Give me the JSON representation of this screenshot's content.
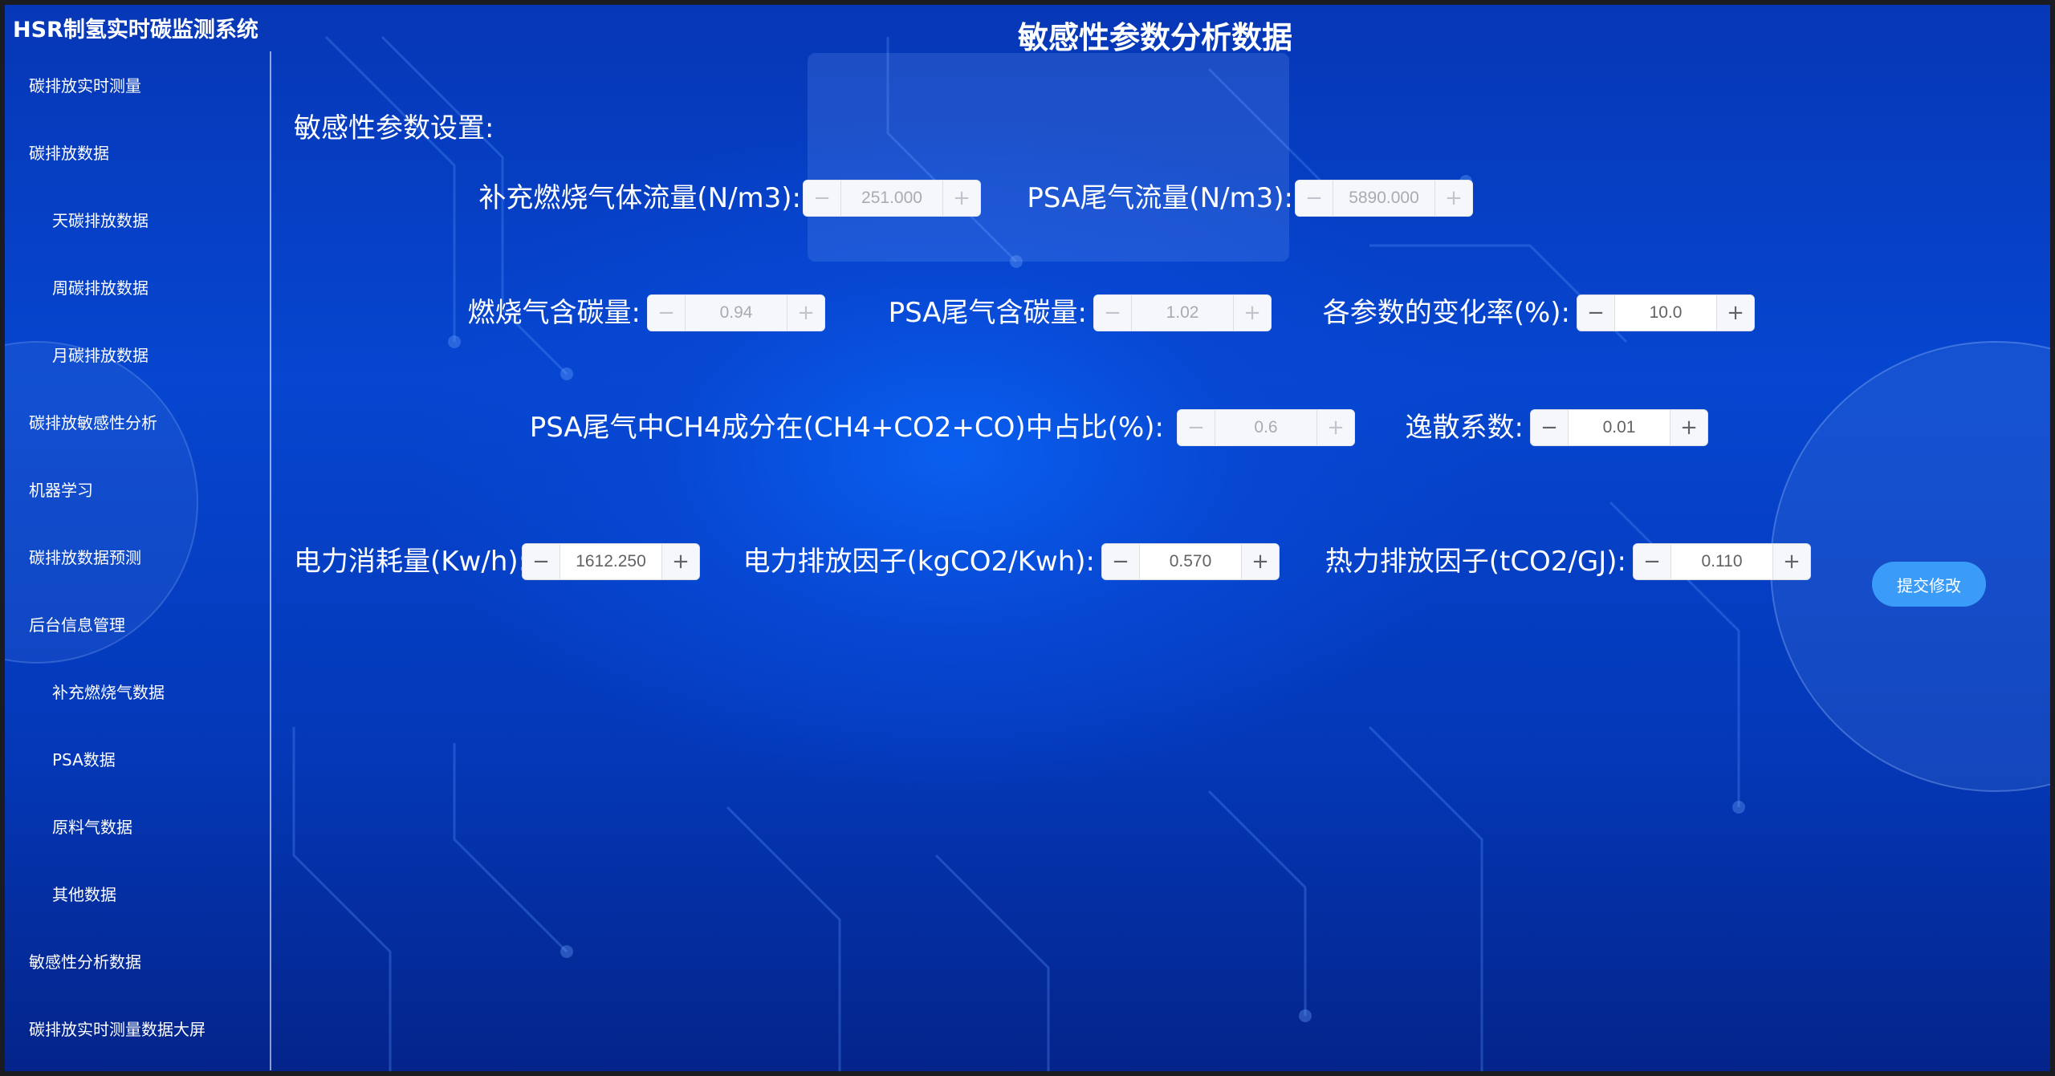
{
  "app": {
    "title": "HSR制氢实时碳监测系统",
    "page_title": "敏感性参数分析数据"
  },
  "sidebar": {
    "items": [
      {
        "label": "碳排放实时测量",
        "level": 1
      },
      {
        "label": "碳排放数据",
        "level": 1
      },
      {
        "label": "天碳排放数据",
        "level": 2
      },
      {
        "label": "周碳排放数据",
        "level": 2
      },
      {
        "label": "月碳排放数据",
        "level": 2
      },
      {
        "label": "碳排放敏感性分析",
        "level": 1
      },
      {
        "label": "机器学习",
        "level": 1
      },
      {
        "label": "碳排放数据预测",
        "level": 1
      },
      {
        "label": "后台信息管理",
        "level": 1
      },
      {
        "label": "补充燃烧气数据",
        "level": 2
      },
      {
        "label": "PSA数据",
        "level": 2
      },
      {
        "label": "原料气数据",
        "level": 2
      },
      {
        "label": "其他数据",
        "level": 2
      },
      {
        "label": "敏感性分析数据",
        "level": 1
      },
      {
        "label": "碳排放实时测量数据大屏",
        "level": 1
      }
    ]
  },
  "form": {
    "section_title": "敏感性参数设置:",
    "fields": {
      "supplement_gas_flow": {
        "label": "补充燃烧气体流量(N/m3):",
        "value": "251.000",
        "disabled": true
      },
      "psa_tail_gas_flow": {
        "label": "PSA尾气流量(N/m3):",
        "value": "5890.000",
        "disabled": true
      },
      "combustion_gas_carbon": {
        "label": "燃烧气含碳量:",
        "value": "0.94",
        "disabled": true
      },
      "psa_tail_gas_carbon": {
        "label": "PSA尾气含碳量:",
        "value": "1.02",
        "disabled": true
      },
      "param_change_rate": {
        "label": "各参数的变化率(%):",
        "value": "10.0",
        "disabled": false
      },
      "psa_ch4_ratio": {
        "label": "PSA尾气中CH4成分在(CH4+CO2+CO)中占比(%):",
        "value": "0.6",
        "disabled": true
      },
      "escape_coefficient": {
        "label": "逸散系数:",
        "value": "0.01",
        "disabled": false
      },
      "power_consumption": {
        "label": "电力消耗量(Kw/h):",
        "value": "1612.250",
        "disabled": false
      },
      "power_emission_factor": {
        "label": "电力排放因子(kgCO2/Kwh):",
        "value": "0.570",
        "disabled": false
      },
      "heat_emission_factor": {
        "label": "热力排放因子(tCO2/GJ):",
        "value": "0.110",
        "disabled": false
      }
    },
    "submit_label": "提交修改"
  },
  "icons": {
    "minus": "minus-icon",
    "plus": "plus-icon"
  },
  "colors": {
    "background_blue": "#0747d2",
    "submit_button": "#3a9cf8",
    "text": "#ffffff"
  }
}
